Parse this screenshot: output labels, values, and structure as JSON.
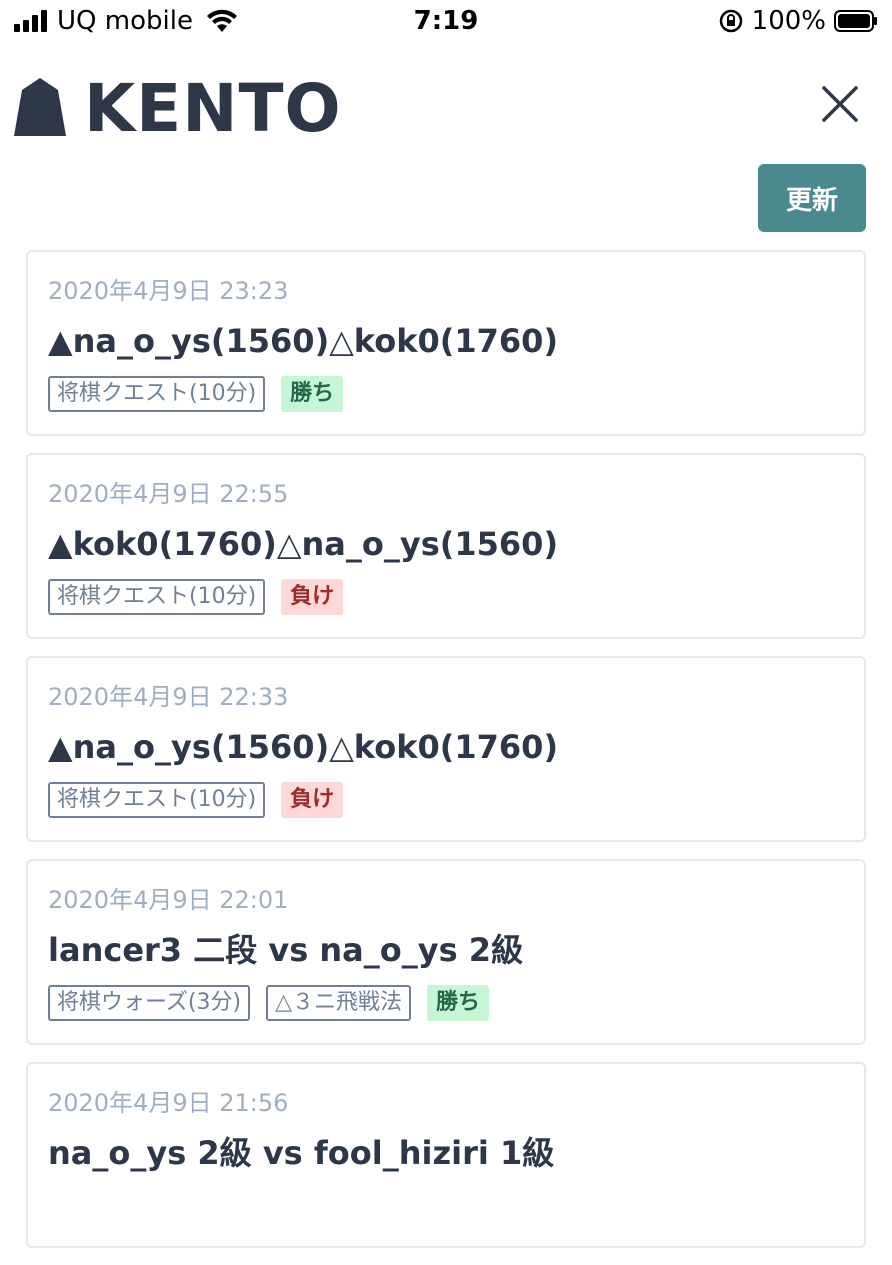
{
  "status_bar": {
    "carrier": "UQ mobile",
    "time": "7:19",
    "battery": "100%"
  },
  "header": {
    "logo_text": "KENTO",
    "refresh_label": "更新"
  },
  "games": [
    {
      "date": "2020年4月9日 23:23",
      "title": "▲na_o_ys(1560)△kok0(1760)",
      "tags": [
        "将棋クエスト(10分)"
      ],
      "result": "勝ち",
      "result_type": "win"
    },
    {
      "date": "2020年4月9日 22:55",
      "title": "▲kok0(1760)△na_o_ys(1560)",
      "tags": [
        "将棋クエスト(10分)"
      ],
      "result": "負け",
      "result_type": "lose"
    },
    {
      "date": "2020年4月9日 22:33",
      "title": "▲na_o_ys(1560)△kok0(1760)",
      "tags": [
        "将棋クエスト(10分)"
      ],
      "result": "負け",
      "result_type": "lose"
    },
    {
      "date": "2020年4月9日 22:01",
      "title": "lancer3 二段 vs na_o_ys 2級",
      "tags": [
        "将棋ウォーズ(3分)",
        "△３ニ飛戦法"
      ],
      "result": "勝ち",
      "result_type": "win"
    },
    {
      "date": "2020年4月9日 21:56",
      "title": "na_o_ys 2級 vs fool_hiziri 1級",
      "tags": [],
      "result": "",
      "result_type": ""
    }
  ],
  "colors": {
    "accent": "#4a8a8f",
    "win_bg": "#c6f6d5",
    "lose_bg": "#fed7d7"
  }
}
